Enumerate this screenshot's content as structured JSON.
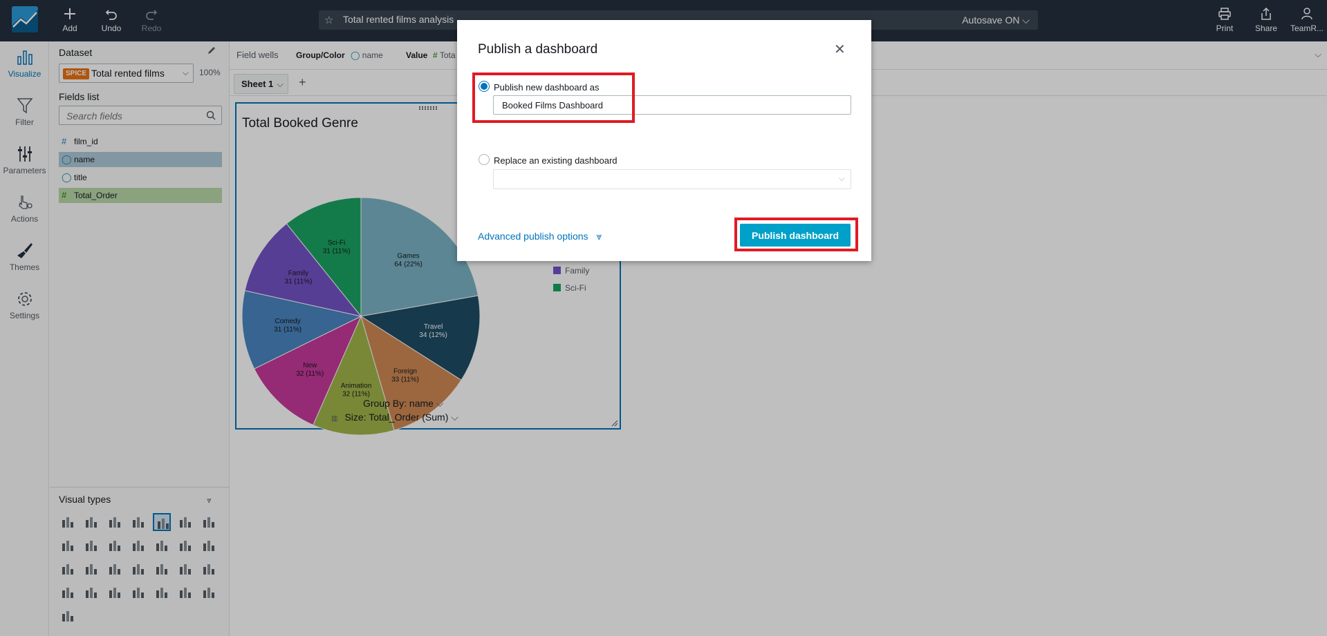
{
  "toolbar": {
    "add_label": "Add",
    "undo_label": "Undo",
    "redo_label": "Redo",
    "analysis_title": "Total rented films analysis",
    "autosave_label": "Autosave ON",
    "print_label": "Print",
    "share_label": "Share",
    "user_label": "TeamR..."
  },
  "left_nav": {
    "items": [
      {
        "label": "Visualize",
        "icon": "bar-chart-icon"
      },
      {
        "label": "Filter",
        "icon": "funnel-icon"
      },
      {
        "label": "Parameters",
        "icon": "sliders-icon"
      },
      {
        "label": "Actions",
        "icon": "pointer-gear-icon"
      },
      {
        "label": "Themes",
        "icon": "paintbrush-icon"
      },
      {
        "label": "Settings",
        "icon": "gear-icon"
      }
    ]
  },
  "data_panel": {
    "dataset_heading": "Dataset",
    "dataset_badge": "SPICE",
    "dataset_name": "Total rented films",
    "dataset_percent": "100%",
    "fields_heading": "Fields list",
    "search_placeholder": "Search fields",
    "fields": [
      {
        "name": "film_id",
        "type": "measure-hash"
      },
      {
        "name": "name",
        "type": "dimension-selected"
      },
      {
        "name": "title",
        "type": "dimension"
      },
      {
        "name": "Total_Order",
        "type": "measure-selected"
      }
    ],
    "visual_types_heading": "Visual types"
  },
  "field_wells": {
    "label": "Field wells",
    "group_color_label": "Group/Color",
    "group_color_value": "name",
    "value_label": "Value",
    "value_value": "Tota"
  },
  "sheet": {
    "tab_label": "Sheet 1"
  },
  "visual": {
    "title": "Total Booked Genre",
    "group_by_label": "Group By: name",
    "size_label": "Size: Total_Order (Sum)"
  },
  "chart_data": {
    "type": "pie",
    "title": "Total Booked Genre",
    "categories": [
      "Games",
      "Travel",
      "Foreign",
      "Animation",
      "New",
      "Comedy",
      "Family",
      "Sci-Fi"
    ],
    "values": [
      64,
      34,
      33,
      32,
      32,
      31,
      31,
      31
    ],
    "labels": [
      "Games\n64 (22%)",
      "Travel\n34 (12%)",
      "Foreign\n33 (11%)",
      "Animation\n32 (11%)",
      "New\n32 (11%)",
      "Comedy\n31 (11%)",
      "Family\n31 (11%)",
      "Sci-Fi\n31 (11%)"
    ],
    "colors": [
      "#7bb3c6",
      "#1e4c66",
      "#d08a55",
      "#a1b64a",
      "#c7399c",
      "#4a86c1",
      "#7553c7",
      "#1aa463"
    ],
    "legend_visible": [
      "Family",
      "Sci-Fi"
    ],
    "legend_position": "right"
  },
  "dialog": {
    "title": "Publish a dashboard",
    "publish_new_label": "Publish new dashboard as",
    "dashboard_name_value": "Booked Films Dashboard",
    "replace_label": "Replace an existing dashboard",
    "advanced_label": "Advanced publish options",
    "publish_button_label": "Publish dashboard",
    "highlight_color": "#e01b24",
    "accent_color": "#00a1c9"
  }
}
